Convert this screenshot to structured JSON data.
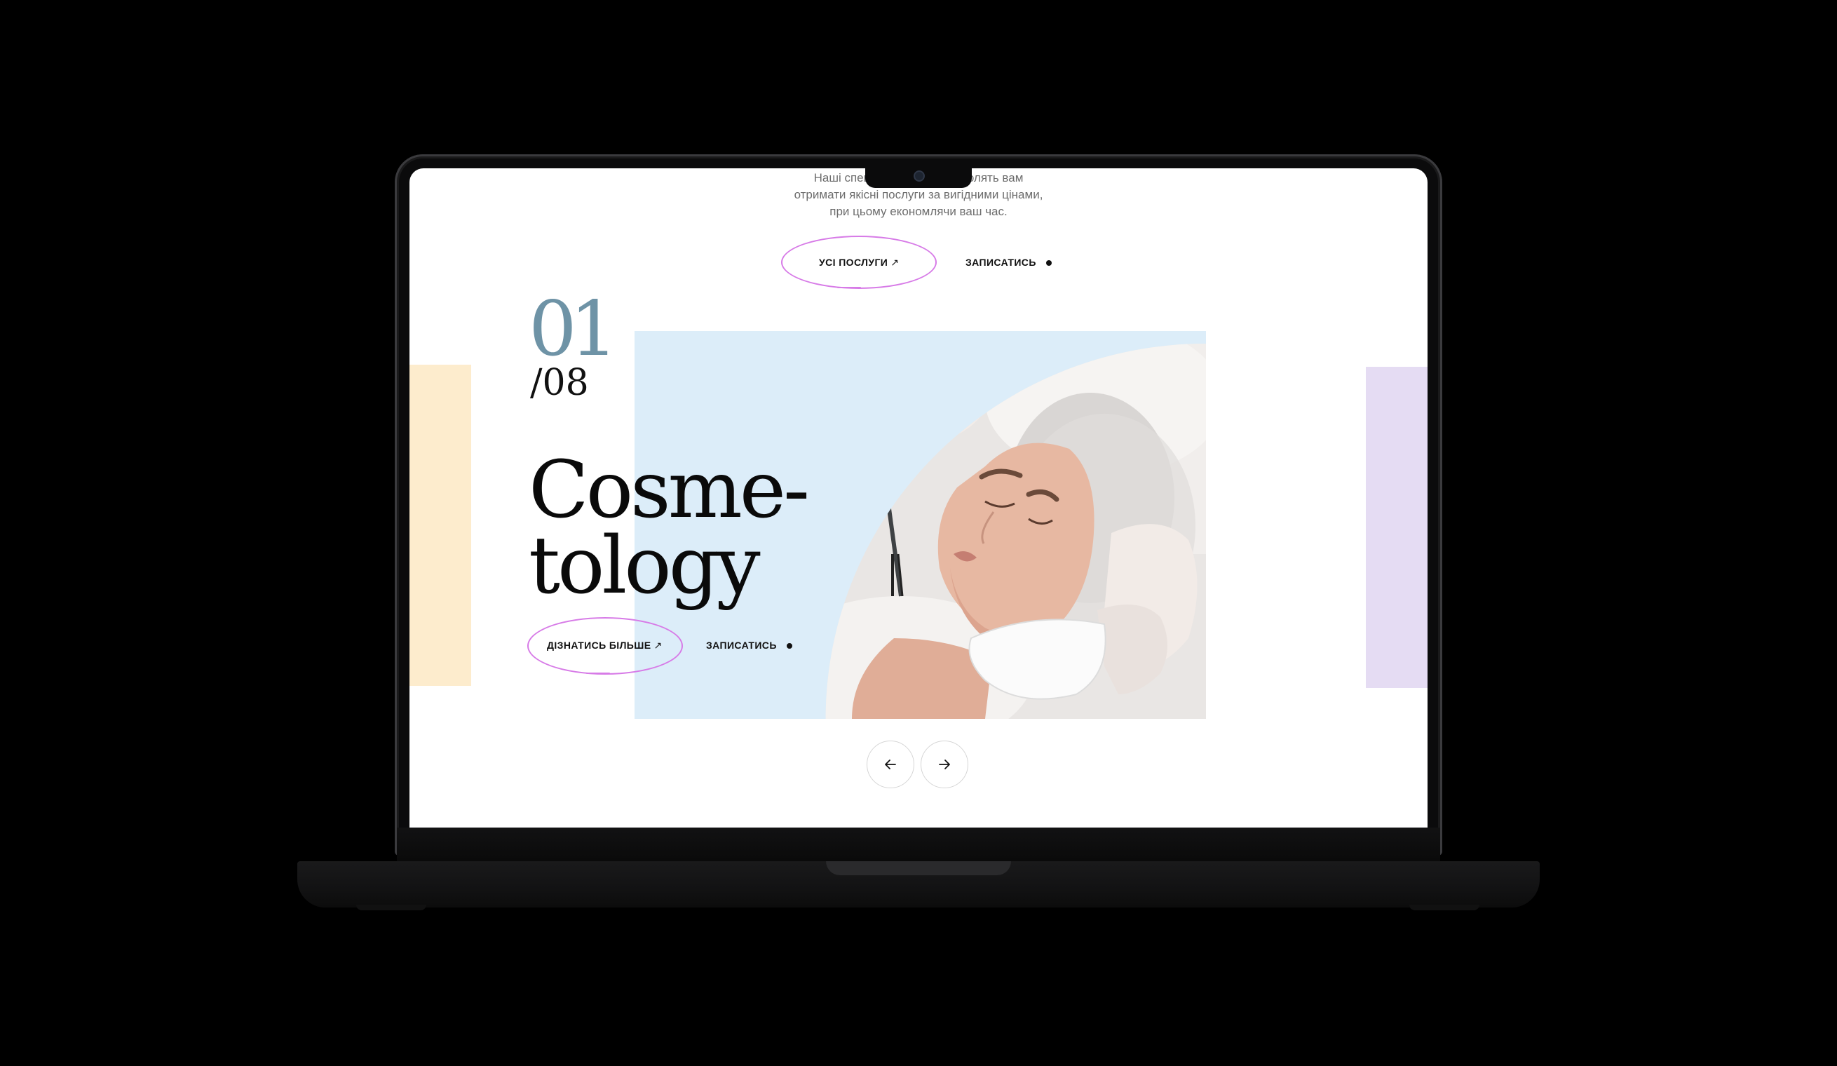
{
  "intro": {
    "lines": [
      "Наші спеці                         зволять вам",
      "отримати якісні послуги за вигідними цінами,",
      "при цьому економлячи ваш час."
    ]
  },
  "top_actions": {
    "all_services": "УСІ ПОСЛУГИ",
    "book": "ЗАПИСАТИСЬ"
  },
  "slide": {
    "current": "01",
    "total": "/08",
    "title_line1": "Cosme-",
    "title_line2": "tology",
    "learn_more": "ДІЗНАТИСЬ БІЛЬШЕ",
    "book": "ЗАПИСАТИСЬ",
    "image_alt": "cosmetologist treating client's face"
  },
  "icons": {
    "arrow_up_right": "↗",
    "prev": "arrow-left-icon",
    "next": "arrow-right-icon"
  },
  "colors": {
    "accent_ellipse": "#d77be7",
    "counter": "#6e93a6",
    "hero_bg": "#dcedf9",
    "left_panel": "#fdeccd",
    "right_panel": "#e5dcf3"
  }
}
